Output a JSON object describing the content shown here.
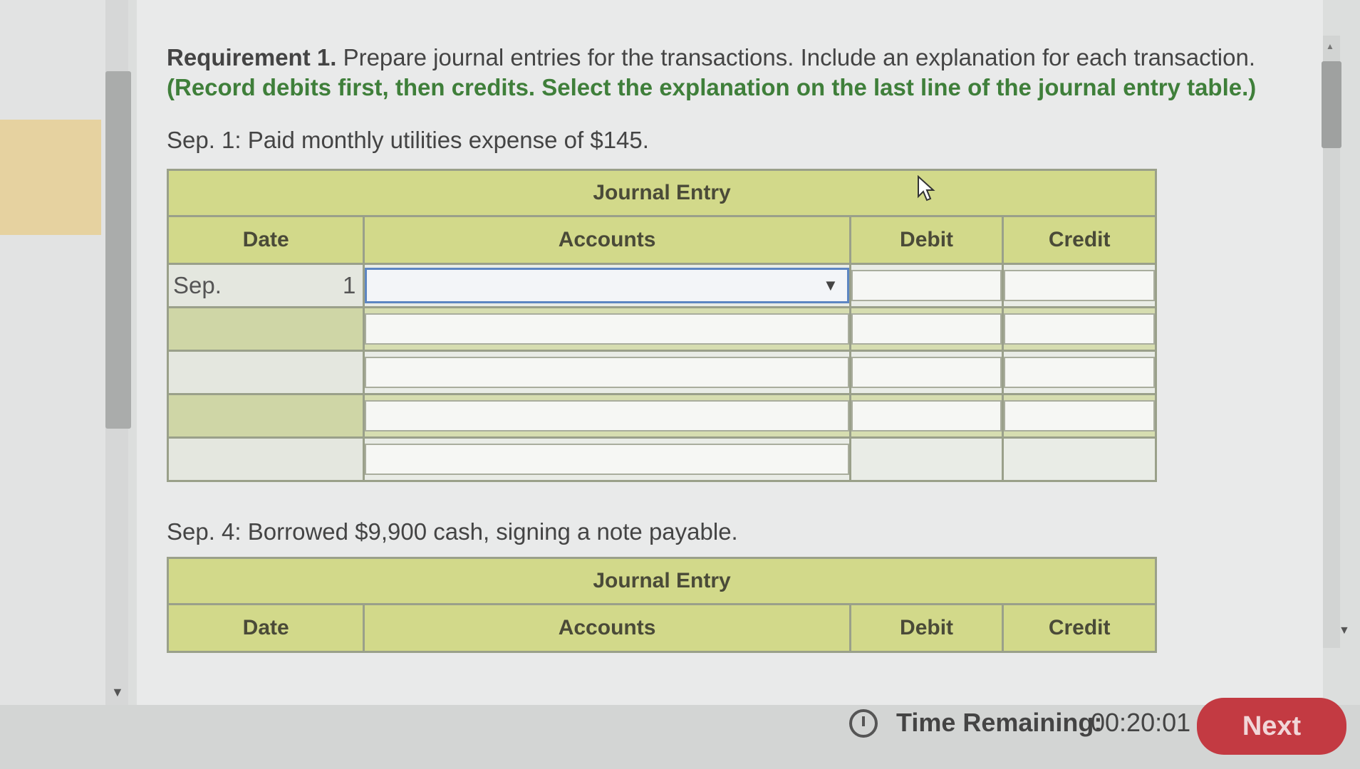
{
  "requirement": {
    "label": "Requirement 1.",
    "text": "Prepare journal entries for the transactions. Include an explanation for each transaction.",
    "instruction": "(Record debits first, then credits. Select the explanation on the last line of the journal entry table.)"
  },
  "transactions": [
    {
      "prompt": "Sep. 1: Paid monthly utilities expense of $145.",
      "table": {
        "title": "Journal Entry",
        "headers": {
          "date": "Date",
          "accounts": "Accounts",
          "debit": "Debit",
          "credit": "Credit"
        },
        "date_month": "Sep.",
        "date_day": "1"
      }
    },
    {
      "prompt": "Sep. 4: Borrowed $9,900 cash, signing a note payable.",
      "table": {
        "title": "Journal Entry",
        "headers": {
          "date": "Date",
          "accounts": "Accounts",
          "debit": "Debit",
          "credit": "Credit"
        }
      }
    }
  ],
  "footer": {
    "time_label": "Time Remaining:",
    "time_value": "00:20:01",
    "next_label": "Next"
  },
  "icons": [
    "clock-icon",
    "dropdown-arrow-icon",
    "mouse-cursor-icon",
    "scroll-up-icon",
    "scroll-down-icon"
  ]
}
